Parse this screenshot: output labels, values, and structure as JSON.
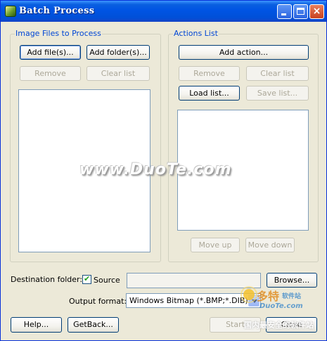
{
  "window": {
    "title": "Batch Process",
    "close_glyph": "×"
  },
  "image_files": {
    "group_title": "Image Files to Process",
    "add_files": "Add file(s)...",
    "add_folders": "Add folder(s)...",
    "remove": "Remove",
    "clear_list": "Clear list",
    "items": []
  },
  "actions": {
    "group_title": "Actions List",
    "add_action": "Add action...",
    "remove": "Remove",
    "clear_list": "Clear list",
    "load_list": "Load list...",
    "save_list": "Save list...",
    "move_up": "Move up",
    "move_down": "Move down",
    "items": []
  },
  "destination": {
    "label": "Destination folder:",
    "source_label": "Source",
    "source_checked": true,
    "check_glyph": "✔",
    "path_value": "",
    "browse": "Browse..."
  },
  "output": {
    "label": "Output format:",
    "selected": "Windows Bitmap (*.BMP;*.DIB)"
  },
  "footer": {
    "help": "Help...",
    "getback": "GetBack...",
    "start": "Start",
    "close": "Close"
  },
  "watermark": {
    "main": "www.DuoTe.com",
    "logo_cn": "多特",
    "logo_cn_small": "软件站",
    "logo_url": "DuoTe.com",
    "logo_slogan": "国内最安全的软件站"
  },
  "colors": {
    "title_bar": "#0054e3",
    "group_title": "#0046d5",
    "face": "#ece9d8"
  }
}
